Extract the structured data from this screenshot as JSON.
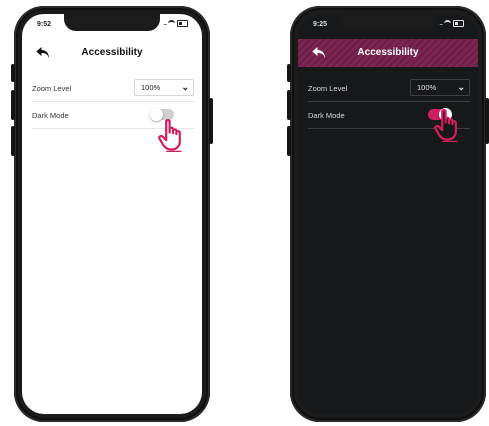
{
  "colors": {
    "accent": "#d01e62",
    "dark_header": "#7a2650",
    "dark_bg": "#16181a"
  },
  "light_phone": {
    "status_time": "9:52",
    "title": "Accessibility",
    "zoom": {
      "label": "Zoom Level",
      "value": "100%"
    },
    "dark_mode": {
      "label": "Dark Mode",
      "state": "off"
    }
  },
  "dark_phone": {
    "status_time": "9:25",
    "title": "Accessibility",
    "zoom": {
      "label": "Zoom Level",
      "value": "100%"
    },
    "dark_mode": {
      "label": "Dark Mode",
      "state": "on"
    }
  },
  "icons": {
    "back": "back-arrow-icon",
    "chevron": "chevron-down-icon",
    "pointer": "hand-pointer-icon"
  }
}
